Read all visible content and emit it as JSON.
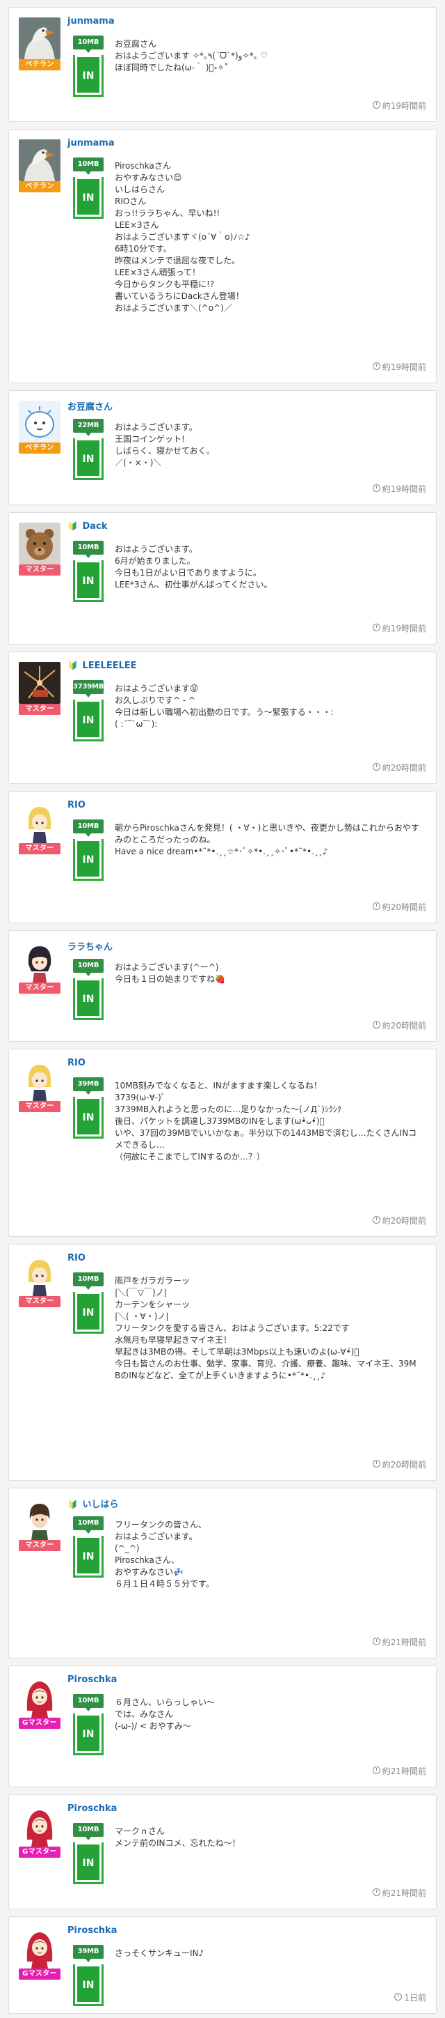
{
  "posts": [
    {
      "user": "junmama",
      "beginner": false,
      "rank": "ベテラン",
      "rank_class": "veteran",
      "size": "10MB",
      "tank": "IN",
      "lines": [
        "お豆腐さん",
        "おはようございます ✧*｡٩(ˊᗜˋ*)و✧*｡ ♡",
        "ほぼ同時でしたね(ω-｀ )ﾟ˖✧˚"
      ],
      "time": "約19時間前"
    },
    {
      "user": "junmama",
      "beginner": false,
      "rank": "ベテラン",
      "rank_class": "veteran",
      "size": "10MB",
      "tank": "IN",
      "lines": [
        "Piroschkaさん",
        "おやすみなさい😌",
        "いしはらさん",
        "RIOさん",
        "おっ!!ララちゃん、早いね!!",
        "LEE×3さん",
        "おはようございますヾ(o´∀｀o)ﾉ☆♪",
        "6時10分です。",
        "昨夜はメンテで退屈な夜でした。",
        "LEE×3さん頑張って！",
        "今日からタンクも平穏に!?",
        "書いているうちにDackさん登場！",
        "おはようございます＼(^o^)／"
      ],
      "time": "約19時間前"
    },
    {
      "user": "お豆腐さん",
      "beginner": false,
      "rank": "ベテラン",
      "rank_class": "veteran",
      "size": "22MB",
      "tank": "IN",
      "lines": [
        "おはようございます。",
        "王国コインゲット!",
        "しばらく、寝かせておく。",
        "／(・×・)＼"
      ],
      "time": "約19時間前"
    },
    {
      "user": "Dack",
      "beginner": true,
      "rank": "マスター",
      "rank_class": "master",
      "size": "10MB",
      "tank": "IN",
      "lines": [
        "おはようございます。",
        "6月が始まりました。",
        "今日も1日がよい日でありますように。",
        "LEE*3さん、初仕事がんばってください。"
      ],
      "time": "約19時間前"
    },
    {
      "user": "LEELEELEE",
      "beginner": true,
      "rank": "マスター",
      "rank_class": "master",
      "size": "3739MB",
      "tank": "IN",
      "lines": [
        "おはようございます😜",
        "お久しぶりです^ ‐ ^",
        "今日は新しい職場へ初出勤の日です。う〜緊張する・・・:",
        "( :´‾`ω‾`):"
      ],
      "time": "約20時間前"
    },
    {
      "user": "RIO",
      "beginner": false,
      "rank": "マスター",
      "rank_class": "master",
      "size": "10MB",
      "tank": "IN",
      "lines": [
        "朝からPiroschkaさんを発見！( ・∀・)と思いきや、夜更かし勢はこれからおやすみのところだったっのね。",
        "Have a nice dream•*¨*•.¸¸☆*･ﾟ✧*•.¸¸✧･ﾟ•*¨*•.¸¸♪"
      ],
      "time": "約20時間前"
    },
    {
      "user": "ララちゃん",
      "beginner": false,
      "rank": "マスター",
      "rank_class": "master",
      "size": "10MB",
      "tank": "IN",
      "lines": [
        "おはようございます(^ー^)",
        "今日も１日の始まりですね🍓"
      ],
      "time": "約20時間前"
    },
    {
      "user": "RIO",
      "beginner": false,
      "rank": "マスター",
      "rank_class": "master",
      "size": "39MB",
      "tank": "IN",
      "lines": [
        "10MB刻みでなくなると、INがますます楽しくなるね！",
        "3739(ω-∀-)ﾟ",
        "3739MB入れようと思ったのに…足りなかった〜(ノД`)ｼｸｼｸ",
        "後日、パケットを調達し3739MBのINをします(ω•̀ᴗ•́)ﾞ",
        "いや、37回の39MBでいいかなぁ。半分以下の1443MBで済むし…たくさんINコメできるし…",
        "（何故にそこまでしてINするのか…？）"
      ],
      "time": "約20時間前"
    },
    {
      "user": "RIO",
      "beginner": false,
      "rank": "マスター",
      "rank_class": "master",
      "size": "10MB",
      "tank": "IN",
      "lines": [
        "雨戸をガラガラーッ",
        "|＼(￣▽￣)ノ|",
        "カーテンをシャーッ",
        "|＼( ・∀・)ノ|",
        "フリータンクを愛する皆さん、おはようございます。5:22です",
        "水無月も早寝早起きマイネ王！",
        "早起きは3MBの得。そして早朝は3Mbps以上も速いのよ(ω-∀•́)ﾞ",
        "今日も皆さんのお仕事、勉学、家事、育児、介護、療養、趣味、マイネ王、39MBのINなどなど、全てが上手くいきますように•*¨*•.¸¸♪"
      ],
      "time": "約20時間前"
    },
    {
      "user": "いしはら",
      "beginner": true,
      "rank": "マスター",
      "rank_class": "master",
      "size": "10MB",
      "tank": "IN",
      "lines": [
        "フリータンクの皆さん、",
        "おはようございます。",
        "(^_^)",
        "Piroschkaさん、",
        "おやすみなさい💤",
        "６月１日４時５５分です。"
      ],
      "time": "約21時間前"
    },
    {
      "user": "Piroschka",
      "beginner": false,
      "rank": "Gマスター",
      "rank_class": "gmaster",
      "size": "10MB",
      "tank": "IN",
      "lines": [
        "６月さん、いらっしゃい〜",
        "では、みなさん",
        "(-ω-)/ < おやすみ〜"
      ],
      "time": "約21時間前"
    },
    {
      "user": "Piroschka",
      "beginner": false,
      "rank": "Gマスター",
      "rank_class": "gmaster",
      "size": "10MB",
      "tank": "IN",
      "lines": [
        "マークｎさん",
        "メンテ前のINコメ、忘れたね〜！"
      ],
      "time": "約21時間前"
    },
    {
      "user": "Piroschka",
      "beginner": false,
      "rank": "Gマスター",
      "rank_class": "gmaster",
      "size": "39MB",
      "tank": "IN",
      "lines": [
        "さっそくサンキューIN♪"
      ],
      "time": "1日前"
    }
  ],
  "beginner_mark": "🔰",
  "avatar_types": [
    "swan",
    "swan",
    "tofu",
    "bear",
    "fireworks",
    "girl-blonde",
    "girl-dark",
    "girl-blonde",
    "girl-blonde",
    "boy",
    "redhood",
    "redhood",
    "redhood"
  ],
  "colors": {
    "accent_green": "#23a235",
    "username_blue": "#1b6bb3",
    "rank_veteran": "#f39c12",
    "rank_master": "#f05a6e",
    "rank_gmaster": "#e61eb4"
  }
}
